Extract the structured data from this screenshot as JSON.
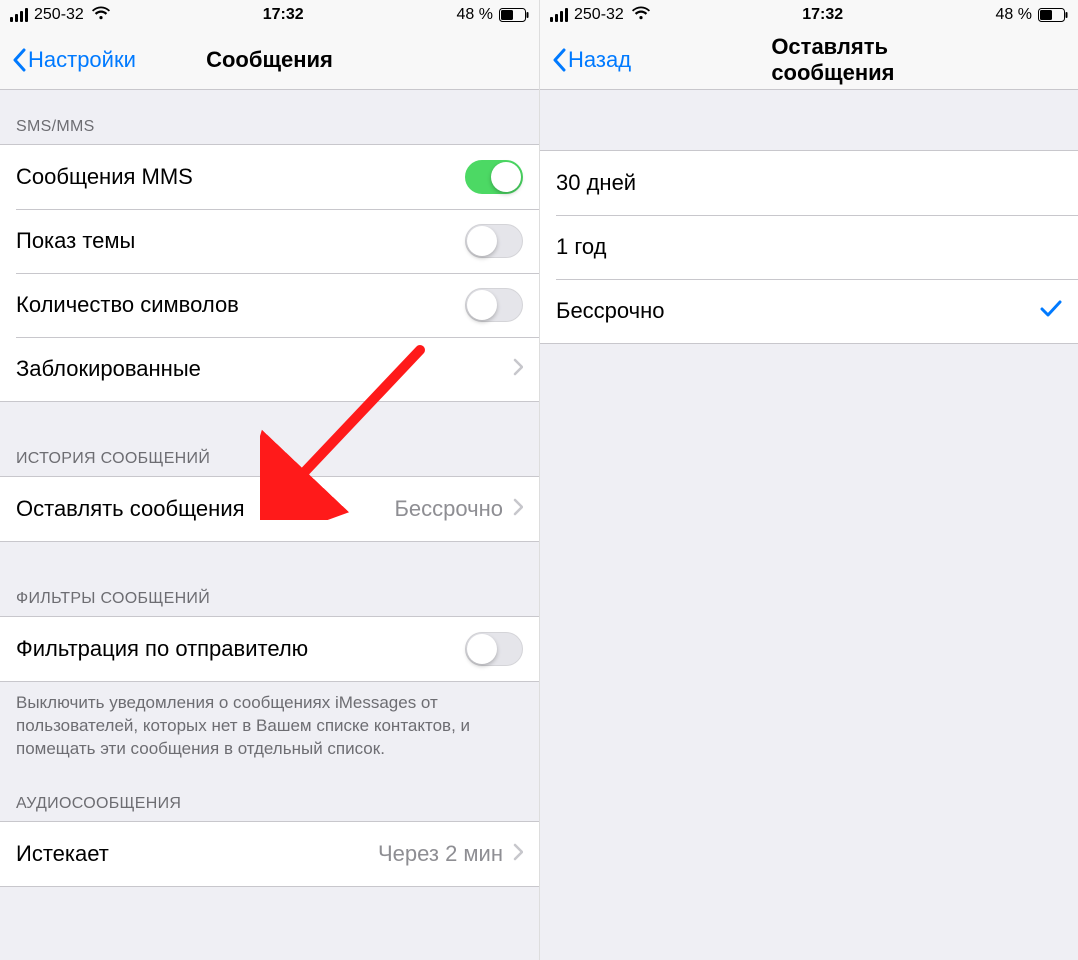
{
  "statusBar": {
    "carrier": "250-32",
    "time": "17:32",
    "batteryPercent": "48 %"
  },
  "left": {
    "backLabel": "Настройки",
    "title": "Сообщения",
    "sections": {
      "smsHeader": "SMS/MMS",
      "mmsLabel": "Сообщения MMS",
      "subjectLabel": "Показ темы",
      "charCountLabel": "Количество символов",
      "blockedLabel": "Заблокированные",
      "historyHeader": "ИСТОРИЯ СООБЩЕНИЙ",
      "keepLabel": "Оставлять сообщения",
      "keepValue": "Бессрочно",
      "filtersHeader": "ФИЛЬТРЫ СООБЩЕНИЙ",
      "filterSenderLabel": "Фильтрация по отправителю",
      "filterFooter": "Выключить уведомления о сообщениях iMessages от пользователей, которых нет в Вашем списке контактов, и помещать эти сообщения в отдельный список.",
      "audioHeader": "АУДИОСООБЩЕНИЯ",
      "expireLabel": "Истекает",
      "expireValue": "Через 2 мин"
    }
  },
  "right": {
    "backLabel": "Назад",
    "title": "Оставлять сообщения",
    "options": {
      "opt30": "30 дней",
      "opt1y": "1 год",
      "optForever": "Бессрочно"
    }
  }
}
